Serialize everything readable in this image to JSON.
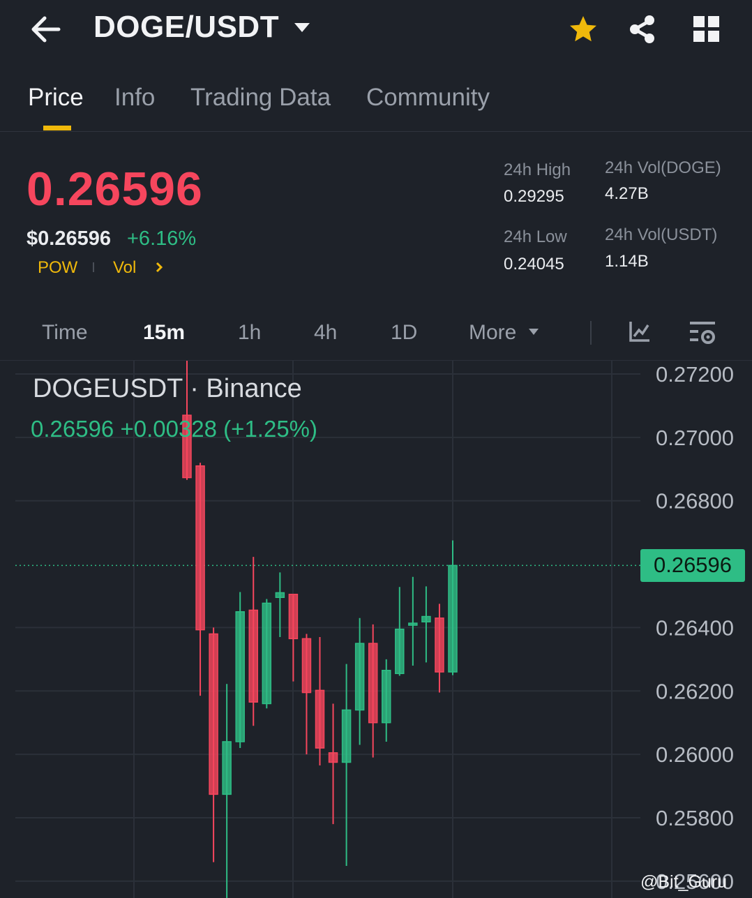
{
  "header": {
    "pair": "DOGE/USDT",
    "icons": [
      "back-arrow-icon",
      "caret-down-icon",
      "star-icon",
      "share-icon",
      "grid-icon"
    ],
    "star_color": "#f0b90b"
  },
  "tabs": [
    {
      "label": "Price",
      "active": true
    },
    {
      "label": "Info",
      "active": false
    },
    {
      "label": "Trading Data",
      "active": false
    },
    {
      "label": "Community",
      "active": false
    }
  ],
  "price": {
    "last": "0.26596",
    "usd": "$0.26596",
    "change_pct": "+6.16%",
    "tags": [
      "POW",
      "Vol"
    ]
  },
  "stats": {
    "high_label": "24h High",
    "high_value": "0.29295",
    "low_label": "24h Low",
    "low_value": "0.24045",
    "vol_base_label": "24h Vol(DOGE)",
    "vol_base_value": "4.27B",
    "vol_quote_label": "24h Vol(USDT)",
    "vol_quote_value": "1.14B"
  },
  "intervals": {
    "items": [
      "Time",
      "15m",
      "1h",
      "4h",
      "1D",
      "More"
    ],
    "active": "15m"
  },
  "colors": {
    "up": "#2ebd85",
    "down": "#f6465d",
    "accent": "#f0b90b",
    "background": "#1e2229"
  },
  "chart_data": {
    "type": "candlestick",
    "title": "DOGEUSDT · Binance",
    "summary": "0.26596  +0.00328 (+1.25%)",
    "last_price": 0.26596,
    "last_price_label": "0.26596",
    "y_ticks": [
      "0.27200",
      "0.27000",
      "0.26800",
      "0.26400",
      "0.26200",
      "0.26000",
      "0.25800",
      "0.25600"
    ],
    "ylim": [
      0.2555,
      0.2722
    ],
    "candles": [
      {
        "o": 0.2707,
        "h": 0.2738,
        "l": 0.26866,
        "c": 0.26873
      },
      {
        "o": 0.2691,
        "h": 0.2692,
        "l": 0.26185,
        "c": 0.26393
      },
      {
        "o": 0.2638,
        "h": 0.264,
        "l": 0.2566,
        "c": 0.25874
      },
      {
        "o": 0.25874,
        "h": 0.26222,
        "l": 0.2551,
        "c": 0.2604
      },
      {
        "o": 0.2604,
        "h": 0.26512,
        "l": 0.2602,
        "c": 0.2645
      },
      {
        "o": 0.26455,
        "h": 0.26623,
        "l": 0.2609,
        "c": 0.26165
      },
      {
        "o": 0.2616,
        "h": 0.2649,
        "l": 0.26145,
        "c": 0.26477
      },
      {
        "o": 0.26495,
        "h": 0.26574,
        "l": 0.2637,
        "c": 0.2651
      },
      {
        "o": 0.26505,
        "h": 0.26502,
        "l": 0.2623,
        "c": 0.26365
      },
      {
        "o": 0.26365,
        "h": 0.2638,
        "l": 0.26,
        "c": 0.26195
      },
      {
        "o": 0.26202,
        "h": 0.2637,
        "l": 0.25965,
        "c": 0.2602
      },
      {
        "o": 0.26005,
        "h": 0.2616,
        "l": 0.2578,
        "c": 0.25975
      },
      {
        "o": 0.25975,
        "h": 0.26285,
        "l": 0.25648,
        "c": 0.2614
      },
      {
        "o": 0.2614,
        "h": 0.2643,
        "l": 0.2603,
        "c": 0.2635
      },
      {
        "o": 0.2635,
        "h": 0.2641,
        "l": 0.2599,
        "c": 0.261
      },
      {
        "o": 0.261,
        "h": 0.263,
        "l": 0.2604,
        "c": 0.26265
      },
      {
        "o": 0.26255,
        "h": 0.26528,
        "l": 0.26248,
        "c": 0.26395
      },
      {
        "o": 0.2641,
        "h": 0.2656,
        "l": 0.2628,
        "c": 0.26414
      },
      {
        "o": 0.26418,
        "h": 0.2653,
        "l": 0.2629,
        "c": 0.26435
      },
      {
        "o": 0.2643,
        "h": 0.26475,
        "l": 0.26195,
        "c": 0.2626
      },
      {
        "o": 0.2626,
        "h": 0.26675,
        "l": 0.2625,
        "c": 0.26596
      }
    ]
  },
  "watermark": "@Bit_Guru"
}
